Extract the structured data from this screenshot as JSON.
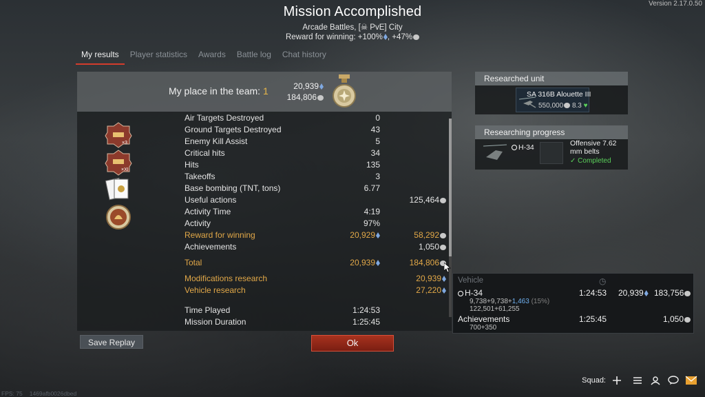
{
  "version": "Version 2.17.0.50",
  "header": {
    "title": "Mission Accomplished",
    "subtitle": "Arcade Battles, [☠ PvE] City",
    "reward_prefix": "Reward for winning: +100%",
    "reward_suffix": ", +47%"
  },
  "tabs": [
    {
      "label": "My results",
      "active": true
    },
    {
      "label": "Player statistics"
    },
    {
      "label": "Awards"
    },
    {
      "label": "Battle log"
    },
    {
      "label": "Chat history"
    }
  ],
  "place": {
    "label": "My place in the team: ",
    "value": "1",
    "rp": "20,939",
    "sl": "184,806"
  },
  "stats": [
    {
      "label": "Air Targets Destroyed",
      "v1": "0",
      "v2": ""
    },
    {
      "label": "Ground Targets Destroyed",
      "v1": "43",
      "v2": ""
    },
    {
      "label": "Enemy Kill Assist",
      "v1": "5",
      "v2": ""
    },
    {
      "label": "Critical hits",
      "v1": "34",
      "v2": ""
    },
    {
      "label": "Hits",
      "v1": "135",
      "v2": ""
    },
    {
      "label": "Takeoffs",
      "v1": "3",
      "v2": ""
    },
    {
      "label": "Base bombing (TNT, tons)",
      "v1": "6.77",
      "v2": ""
    },
    {
      "label": "Useful actions",
      "v1": "",
      "v2": "125,464"
    },
    {
      "label": "Activity Time",
      "v1": "4:19",
      "v2": ""
    },
    {
      "label": "Activity",
      "v1": "97%",
      "v2": ""
    },
    {
      "label": "Reward for winning",
      "v1": "20,929",
      "v2": "58,292"
    },
    {
      "label": "Achievements",
      "v1": "",
      "v2": "1,050"
    },
    {
      "label": "Total",
      "v1": "20,939",
      "v2": "184,806"
    },
    {
      "label": "Modifications research",
      "v1": "",
      "v2": "20,939"
    },
    {
      "label": "Vehicle research",
      "v1": "",
      "v2": "27,220"
    },
    {
      "label": "Time Played",
      "v1": "1:24:53",
      "v2": ""
    },
    {
      "label": "Mission Duration",
      "v1": "1:25:45",
      "v2": ""
    }
  ],
  "buttons": {
    "save_replay": "Save Replay",
    "ok": "Ok"
  },
  "researched_unit": {
    "title": "Researched unit",
    "name": "SA 316B Alouette III",
    "cost": "550,000",
    "br": "8.3"
  },
  "researching": {
    "title": "Researching progress",
    "vehicle": "H-34",
    "item": "Offensive 7.62 mm belts",
    "status": "Completed"
  },
  "tooltip": {
    "head": "Vehicle",
    "vehicle": "H-34",
    "vehicle_time": "1:24:53",
    "vehicle_rp": "20,939",
    "vehicle_sl": "183,756",
    "line1_a": "9,738",
    "line1_b": "9,738",
    "line1_c": "1,463",
    "line1_d": "(15%)",
    "line2_a": "122,501",
    "line2_b": "61,255",
    "ach_label": "Achievements",
    "ach_time": "1:25:45",
    "ach_sl": "1,050",
    "ach_a": "700",
    "ach_b": "350"
  },
  "bottom": {
    "squad": "Squad:",
    "fps": "FPS: 75",
    "id": "1469afb0026dbed"
  }
}
